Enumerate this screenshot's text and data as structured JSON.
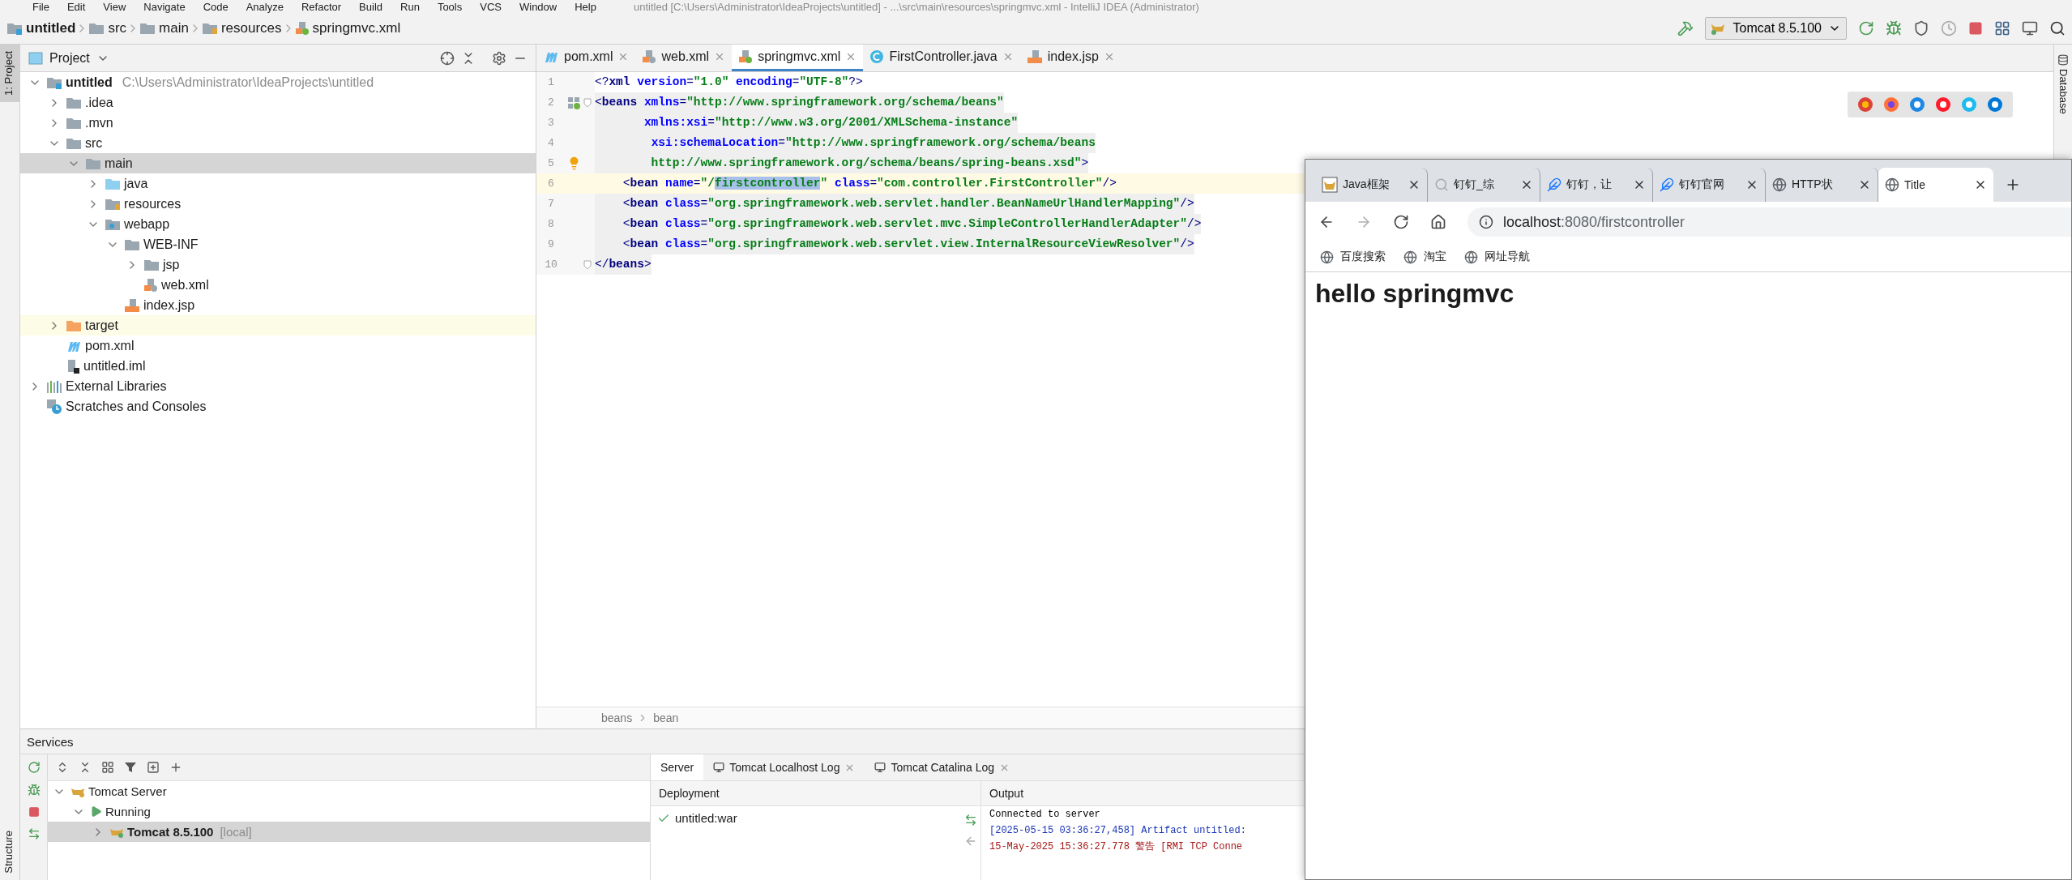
{
  "menu_bar": {
    "items": [
      "File",
      "Edit",
      "View",
      "Navigate",
      "Code",
      "Analyze",
      "Refactor",
      "Build",
      "Run",
      "Tools",
      "VCS",
      "Window",
      "Help"
    ],
    "title": "untitled [C:\\Users\\Administrator\\IdeaProjects\\untitled] - ...\\src\\main\\resources\\springmvc.xml - IntelliJ IDEA (Administrator)"
  },
  "breadcrumbs": [
    {
      "label": "untitled",
      "kind": "module"
    },
    {
      "label": "src",
      "kind": "folder"
    },
    {
      "label": "main",
      "kind": "folder"
    },
    {
      "label": "resources",
      "kind": "resource-folder"
    },
    {
      "label": "springmvc.xml",
      "kind": "spring-xml"
    }
  ],
  "run_config": {
    "label": "Tomcat 8.5.100"
  },
  "left_strip": {
    "top": "1: Project",
    "bottom": "Structure"
  },
  "right_strip": {
    "label": "Database"
  },
  "project_panel": {
    "title": "Project",
    "tree": [
      {
        "name": "untitled",
        "hint": "C:\\Users\\Administrator\\IdeaProjects\\untitled",
        "kind": "module",
        "expanded": true,
        "selected": false,
        "highlighted": false,
        "children": [
          {
            "name": ".idea",
            "kind": "folder",
            "expanded": false,
            "selected": false,
            "highlighted": false
          },
          {
            "name": ".mvn",
            "kind": "folder",
            "expanded": false,
            "selected": false,
            "highlighted": false
          },
          {
            "name": "src",
            "kind": "folder",
            "expanded": true,
            "selected": false,
            "highlighted": false,
            "children": [
              {
                "name": "main",
                "kind": "folder",
                "expanded": true,
                "selected": true,
                "highlighted": false,
                "children": [
                  {
                    "name": "java",
                    "kind": "source-folder",
                    "expanded": false,
                    "selected": false,
                    "highlighted": false
                  },
                  {
                    "name": "resources",
                    "kind": "resource-folder",
                    "expanded": false,
                    "selected": false,
                    "highlighted": false
                  },
                  {
                    "name": "webapp",
                    "kind": "web-folder",
                    "expanded": true,
                    "selected": false,
                    "highlighted": false,
                    "children": [
                      {
                        "name": "WEB-INF",
                        "kind": "folder",
                        "expanded": true,
                        "selected": false,
                        "highlighted": false,
                        "children": [
                          {
                            "name": "jsp",
                            "kind": "folder",
                            "expanded": false,
                            "selected": false,
                            "highlighted": false
                          },
                          {
                            "name": "web.xml",
                            "kind": "web-xml",
                            "selected": false,
                            "highlighted": false
                          }
                        ]
                      },
                      {
                        "name": "index.jsp",
                        "kind": "jsp",
                        "selected": false,
                        "highlighted": false
                      }
                    ]
                  }
                ]
              }
            ]
          },
          {
            "name": "target",
            "kind": "excluded-folder",
            "expanded": false,
            "selected": false,
            "highlighted": true
          },
          {
            "name": "pom.xml",
            "kind": "maven",
            "selected": false,
            "highlighted": false
          },
          {
            "name": "untitled.iml",
            "kind": "iml",
            "selected": false,
            "highlighted": false
          }
        ]
      },
      {
        "name": "External Libraries",
        "kind": "libraries",
        "expanded": false,
        "selected": false,
        "highlighted": false
      },
      {
        "name": "Scratches and Consoles",
        "kind": "scratches",
        "selected": false,
        "highlighted": false
      }
    ]
  },
  "editor": {
    "tabs": [
      {
        "label": "pom.xml",
        "kind": "maven",
        "selected": false
      },
      {
        "label": "web.xml",
        "kind": "web-xml",
        "selected": false
      },
      {
        "label": "springmvc.xml",
        "kind": "spring-xml",
        "selected": true
      },
      {
        "label": "FirstController.java",
        "kind": "java-class",
        "selected": false
      },
      {
        "label": "index.jsp",
        "kind": "jsp",
        "selected": false
      }
    ],
    "lines": [
      {
        "number": "1",
        "text": "<?xml version=\"1.0\" encoding=\"UTF-8\"?>",
        "shaded": false,
        "current": false,
        "fold": false
      },
      {
        "number": "2",
        "text": "<beans xmlns=\"http://www.springframework.org/schema/beans\"",
        "shaded": true,
        "current": false,
        "fold": true
      },
      {
        "number": "3",
        "text": "       xmlns:xsi=\"http://www.w3.org/2001/XMLSchema-instance\"",
        "shaded": true,
        "current": false,
        "fold": false
      },
      {
        "number": "4",
        "text": "        xsi:schemaLocation=\"http://www.springframework.org/schema/beans",
        "shaded": true,
        "current": false,
        "fold": false
      },
      {
        "number": "5",
        "text": "        http://www.springframework.org/schema/beans/spring-beans.xsd\">",
        "shaded": true,
        "current": false,
        "fold": false
      },
      {
        "number": "6",
        "text_before": "    <bean name=\"/",
        "selected_text": "firstcontroller",
        "text_after": "\" class=\"com.controller.FirstController\"/>",
        "shaded": false,
        "current": true,
        "fold": false
      },
      {
        "number": "7",
        "text": "    <bean class=\"org.springframework.web.servlet.handler.BeanNameUrlHandlerMapping\"/>",
        "shaded": true,
        "current": false,
        "fold": false
      },
      {
        "number": "8",
        "text": "    <bean class=\"org.springframework.web.servlet.mvc.SimpleControllerHandlerAdapter\"/>",
        "shaded": true,
        "current": false,
        "fold": false
      },
      {
        "number": "9",
        "text": "    <bean class=\"org.springframework.web.servlet.view.InternalResourceViewResolver\"/>",
        "shaded": true,
        "current": false,
        "fold": false
      },
      {
        "number": "10",
        "text": "</beans>",
        "shaded": true,
        "current": false,
        "fold": true
      }
    ],
    "breadcrumbs": [
      "beans",
      "bean"
    ]
  },
  "services": {
    "title": "Services",
    "tree": [
      {
        "label": "Tomcat Server",
        "kind": "group",
        "expanded": true,
        "selected": false,
        "children": [
          {
            "label": "Running",
            "kind": "status",
            "expanded": true,
            "selected": false,
            "children": [
              {
                "label": "Tomcat 8.5.100",
                "hint": "[local]",
                "kind": "server",
                "expanded": false,
                "selected": true
              }
            ]
          }
        ]
      }
    ],
    "tabs": [
      {
        "label": "Server",
        "selected": true,
        "closable": false
      },
      {
        "label": "Tomcat Localhost Log",
        "selected": false,
        "closable": true
      },
      {
        "label": "Tomcat Catalina Log",
        "selected": false,
        "closable": true
      }
    ],
    "deployment": {
      "heading": "Deployment",
      "items": [
        {
          "label": "untitled:war"
        }
      ]
    },
    "output": {
      "heading": "Output",
      "lines": [
        {
          "text": "Connected to server",
          "kind": "plain"
        },
        {
          "text": "[2025-05-15 03:36:27,458] Artifact untitled:",
          "kind": "artifact"
        },
        {
          "text": "15-May-2025 15:36:27.778 警告 [RMI TCP Conne",
          "kind": "warning"
        }
      ]
    }
  },
  "browser": {
    "tabs": [
      {
        "title": "Java框架",
        "kind": "tomcat",
        "selected": false
      },
      {
        "title": "钉钉_综",
        "kind": "search",
        "selected": false
      },
      {
        "title": "钉钉，让",
        "kind": "feather",
        "selected": false
      },
      {
        "title": "钉钉官网",
        "kind": "feather",
        "selected": false
      },
      {
        "title": "HTTP状",
        "kind": "globe",
        "selected": false
      },
      {
        "title": "Title",
        "kind": "globe",
        "selected": true
      }
    ],
    "nav": [
      {
        "kind": "back",
        "disabled": false
      },
      {
        "kind": "forward",
        "disabled": true
      },
      {
        "kind": "reload",
        "disabled": false
      },
      {
        "kind": "home",
        "disabled": false
      }
    ],
    "url": {
      "host": "localhost",
      "path": ":8080/firstcontroller"
    },
    "bookmarks": [
      "百度搜索",
      "淘宝",
      "网址导航"
    ],
    "heading": "hello springmvc"
  }
}
